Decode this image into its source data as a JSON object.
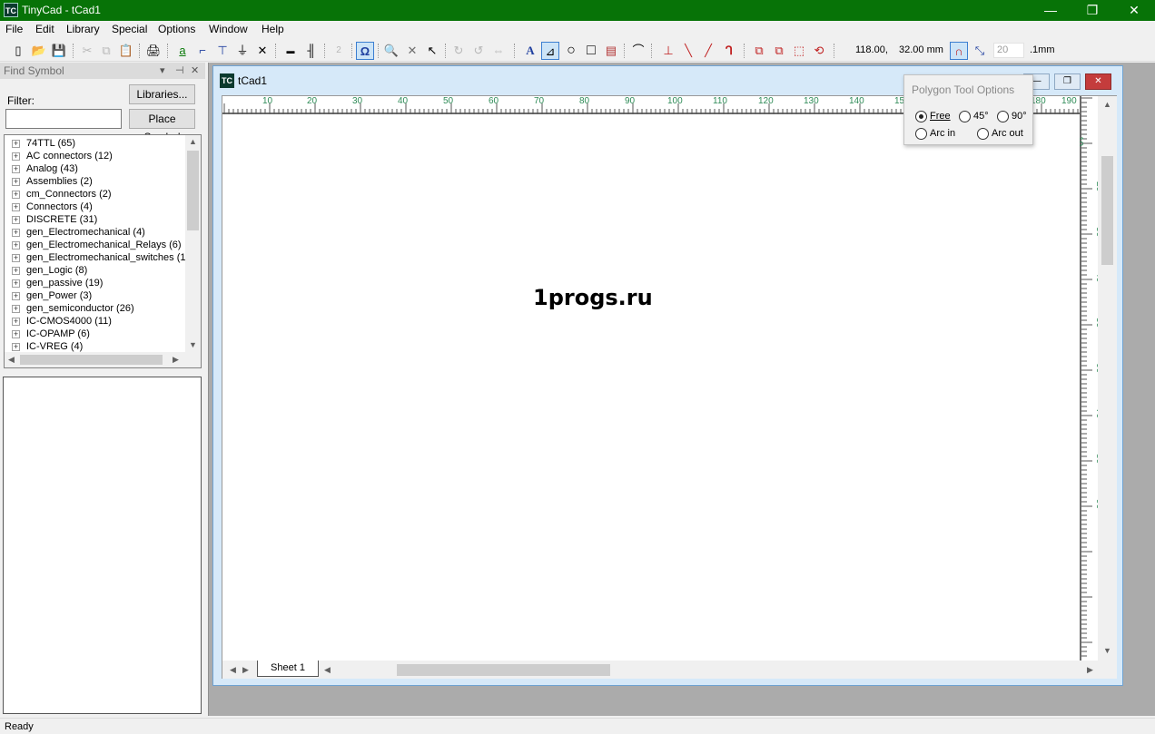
{
  "window": {
    "icon_text": "TC",
    "title": "TinyCad - tCad1",
    "min": "—",
    "max": "❐",
    "close": "✕"
  },
  "menu": [
    "File",
    "Edit",
    "Library",
    "Special",
    "Options",
    "Window",
    "Help"
  ],
  "toolbar": {
    "coords": "118.00,",
    "coords_y": "32.00 mm",
    "grid_value": "20",
    "grid_unit": ".1mm",
    "icons": {
      "new": "▯",
      "open": "📂",
      "save": "💾",
      "cut": "✂",
      "copy": "⧉",
      "paste": "📋",
      "print": "🖨",
      "label": "a",
      "wire": "⌐",
      "power": "⊤",
      "ground": "⏚",
      "no_connect": "✕",
      "bus": "▬",
      "bus_entry": "╢",
      "bus_name": "2",
      "pin": "Ω",
      "zoom": "🔍",
      "delete": "✕",
      "select": "↖",
      "rotate": "↻",
      "rotate2": "↺",
      "mirror": "⇔",
      "text": "A",
      "polygon": "⊿",
      "circle": "○",
      "square": "□",
      "note": "▤",
      "arc": "⌒",
      "junction": "⊥",
      "line_red": "╲",
      "line_red2": "╱",
      "connector": "ᒉ",
      "design1": "⧉",
      "design2": "⧉",
      "design3": "⬚",
      "design4": "⟲",
      "magnet": "∩",
      "snap": "⤡"
    }
  },
  "find_panel": {
    "title": "Find Symbol",
    "ctrl_dropdown": "▾",
    "ctrl_pin": "⊣",
    "ctrl_close": "✕",
    "filter_label": "Filter:",
    "filter_value": "",
    "libraries_button": "Libraries...",
    "place_button": "Place Symbol",
    "tree_items": [
      "74TTL (65)",
      "AC connectors (12)",
      "Analog (43)",
      "Assemblies (2)",
      "cm_Connectors (2)",
      "Connectors (4)",
      "DISCRETE (31)",
      "gen_Electromechanical (4)",
      "gen_Electromechanical_Relays (6)",
      "gen_Electromechanical_switches (15",
      "gen_Logic (8)",
      "gen_passive (19)",
      "gen_Power (3)",
      "gen_semiconductor (26)",
      "IC-CMOS4000 (11)",
      "IC-OPAMP (6)",
      "IC-VREG (4)"
    ],
    "expander": "⊞"
  },
  "document": {
    "icon_text": "TC",
    "title": "tCad1",
    "ruler_h": [
      "10",
      "20",
      "30",
      "40",
      "50",
      "60",
      "70",
      "80",
      "90",
      "100",
      "110",
      "120",
      "130",
      "140",
      "150",
      "160",
      "170",
      "180",
      "190"
    ],
    "ruler_v": [
      "10",
      "20",
      "30",
      "40",
      "50",
      "60",
      "70",
      "80",
      "90",
      "100",
      "110",
      "120"
    ],
    "watermark": "1progs.ru",
    "sheet_tab": "Sheet 1"
  },
  "polygon_options": {
    "title": "Polygon Tool Options",
    "free": "Free",
    "deg45": "45°",
    "deg90": "90°",
    "arc_in": "Arc in",
    "arc_out": "Arc out",
    "selected": "Free"
  },
  "status": {
    "text": "Ready"
  },
  "colors": {
    "titlebar": "#077307",
    "accent": "#3c7fd1",
    "ruler_text": "#2e8b57"
  }
}
